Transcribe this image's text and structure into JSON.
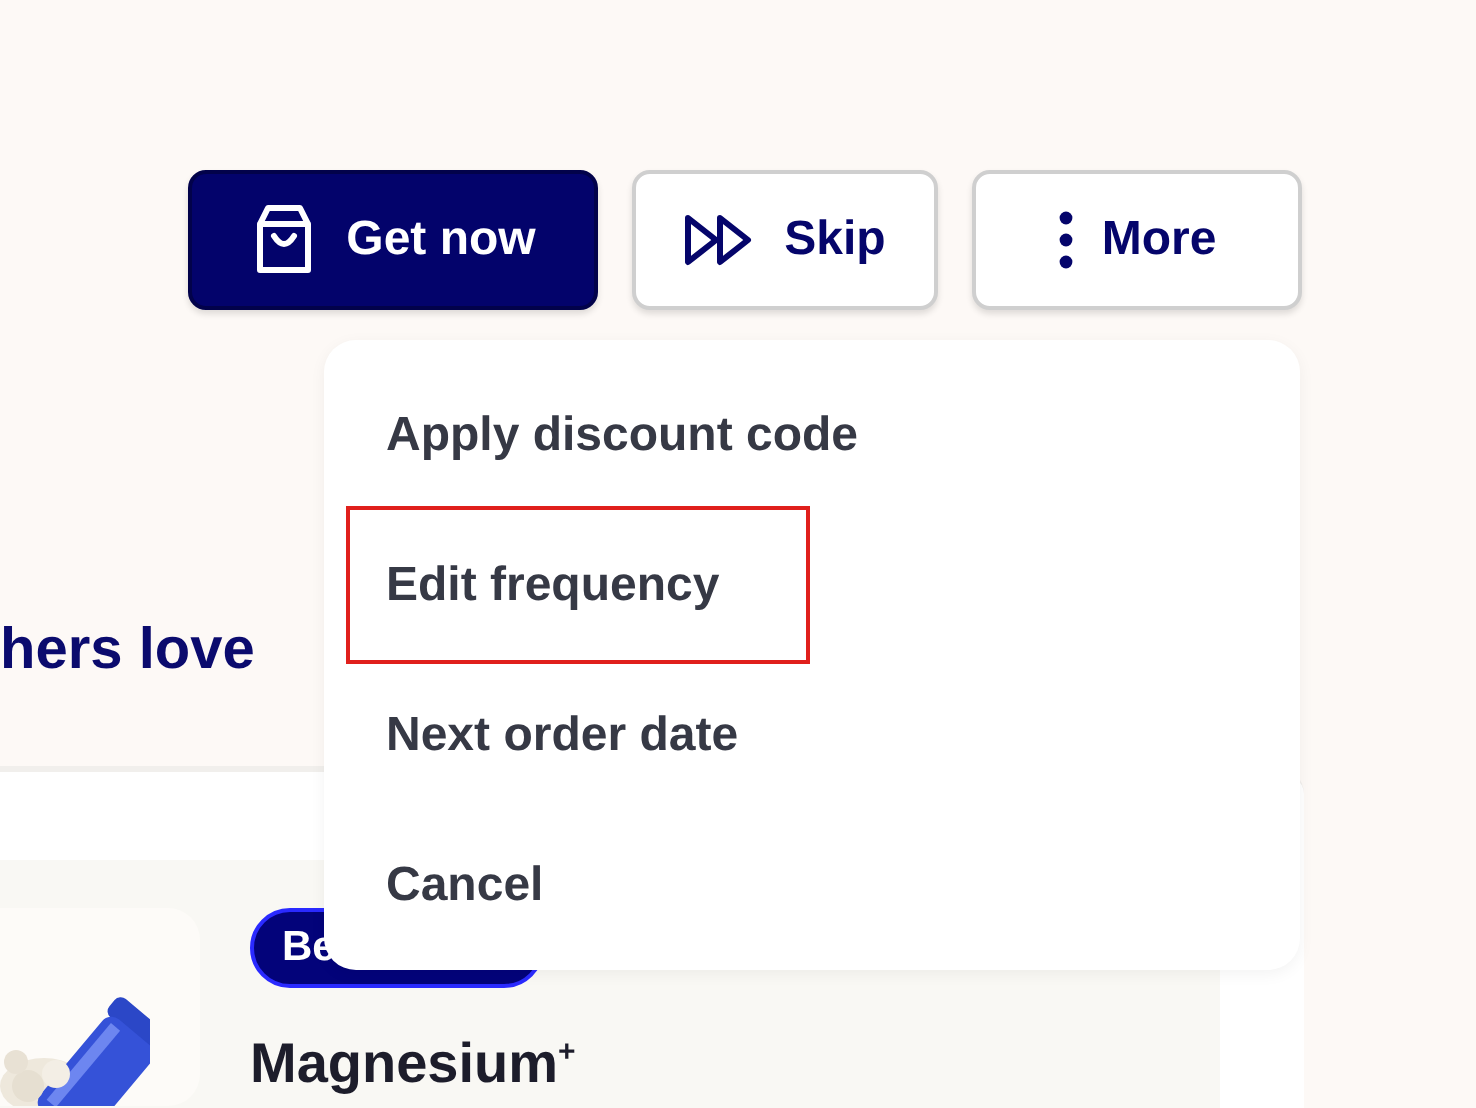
{
  "actions": [
    {
      "label": "Get now",
      "kind": "primary"
    },
    {
      "label": "Skip",
      "kind": "skip"
    },
    {
      "label": "More",
      "kind": "more"
    }
  ],
  "heading": "hers love",
  "product": {
    "badge": "Be",
    "title": "Magnesium$^{+}$"
  },
  "menu": {
    "items": [
      {
        "label": "Apply discount code",
        "selected": false
      },
      {
        "label": "Edit frequency",
        "selected": true
      },
      {
        "label": "Next order date",
        "selected": false
      },
      {
        "label": "Cancel",
        "selected": false
      }
    ]
  }
}
